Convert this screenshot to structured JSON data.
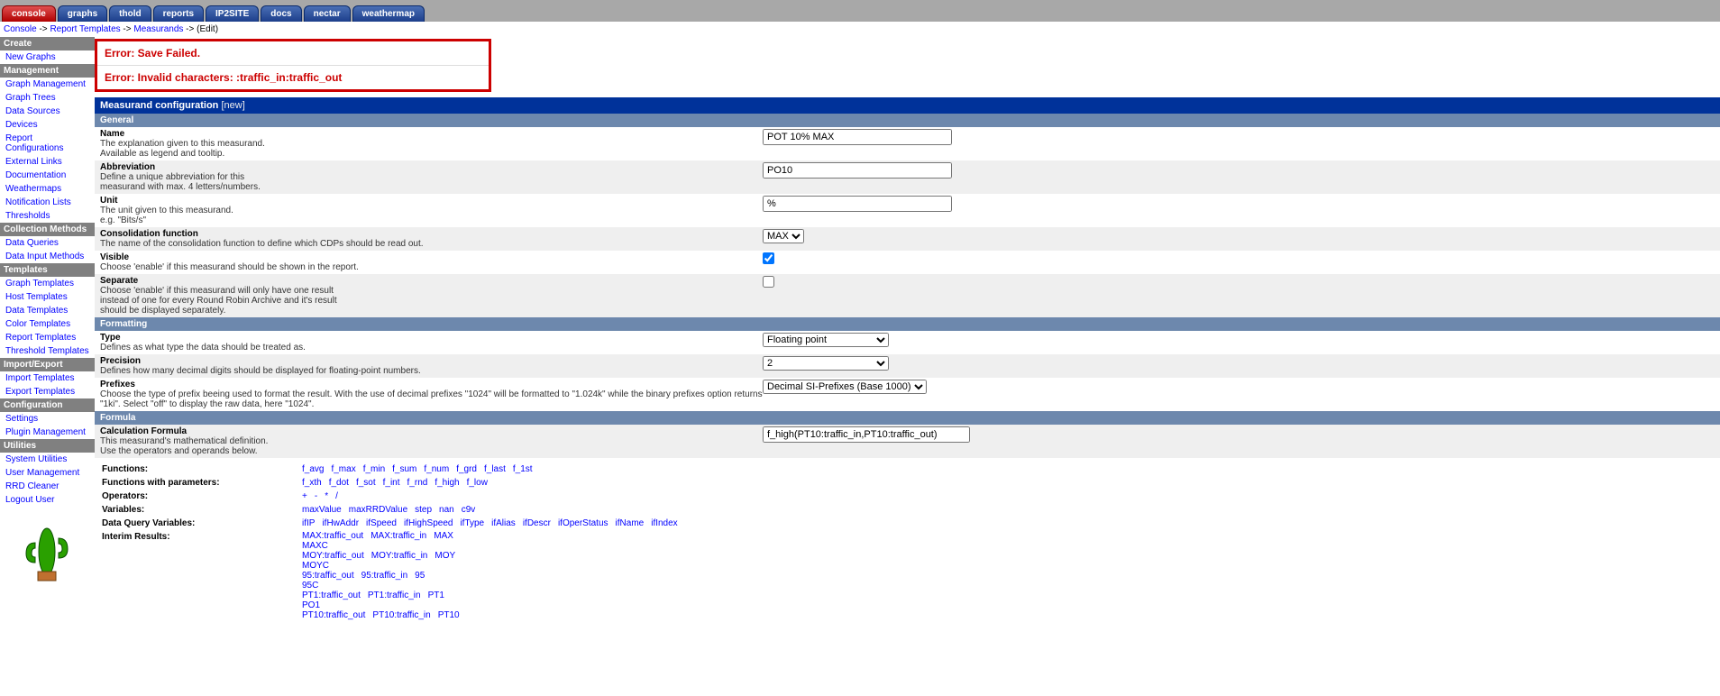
{
  "tabs": [
    {
      "label": "console",
      "active": true
    },
    {
      "label": "graphs"
    },
    {
      "label": "thold"
    },
    {
      "label": "reports"
    },
    {
      "label": "IP2SITE"
    },
    {
      "label": "docs"
    },
    {
      "label": "nectar"
    },
    {
      "label": "weathermap"
    }
  ],
  "breadcrumb": {
    "p0": "Console",
    "sep": " -> ",
    "p1": "Report Templates",
    "p2": "Measurands",
    "p3": "(Edit)"
  },
  "sidebar": {
    "groups": [
      {
        "title": "Create",
        "items": [
          "New Graphs"
        ]
      },
      {
        "title": "Management",
        "items": [
          "Graph Management",
          "Graph Trees",
          "Data Sources",
          "Devices",
          "Report Configurations",
          "External Links",
          "Documentation",
          "Weathermaps",
          "Notification Lists",
          "Thresholds"
        ]
      },
      {
        "title": "Collection Methods",
        "items": [
          "Data Queries",
          "Data Input Methods"
        ]
      },
      {
        "title": "Templates",
        "items": [
          "Graph Templates",
          "Host Templates",
          "Data Templates",
          "Color Templates",
          "Report Templates",
          "Threshold Templates"
        ]
      },
      {
        "title": "Import/Export",
        "items": [
          "Import Templates",
          "Export Templates"
        ]
      },
      {
        "title": "Configuration",
        "items": [
          "Settings",
          "Plugin Management"
        ]
      },
      {
        "title": "Utilities",
        "items": [
          "System Utilities",
          "User Management",
          "RRD Cleaner",
          "Logout User"
        ]
      }
    ]
  },
  "errors": {
    "e1": "Error: Save Failed.",
    "e2": "Error: Invalid characters: :traffic_in:traffic_out"
  },
  "panel": {
    "title": "Measurand configuration",
    "suffix": "[new]",
    "sections": {
      "general": "General",
      "formatting": "Formatting",
      "formula": "Formula"
    },
    "fields": {
      "name": {
        "t": "Name",
        "d": "The explanation given to this measurand.\nAvailable as legend and tooltip.",
        "v": "POT 10% MAX"
      },
      "abbr": {
        "t": "Abbreviation",
        "d": "Define a unique abbreviation for this\nmeasurand with max. 4 letters/numbers.",
        "v": "PO10"
      },
      "unit": {
        "t": "Unit",
        "d": "The unit given to this measurand.\ne.g. \"Bits/s\"",
        "v": "%"
      },
      "cf": {
        "t": "Consolidation function",
        "d": "The name of the consolidation function to define which CDPs should be read out.",
        "v": "MAX"
      },
      "visible": {
        "t": "Visible",
        "d": "Choose 'enable' if this measurand should be shown in the report.",
        "v": true
      },
      "separate": {
        "t": "Separate",
        "d": "Choose 'enable' if this measurand will only have one result\ninstead of one for every Round Robin Archive and it's result\nshould be displayed separately.",
        "v": false
      },
      "type": {
        "t": "Type",
        "d": "Defines as what type the data should be treated as.",
        "v": "Floating point"
      },
      "precision": {
        "t": "Precision",
        "d": "Defines how many decimal digits should be displayed for floating-point numbers.",
        "v": "2"
      },
      "prefixes": {
        "t": "Prefixes",
        "d": "Choose the type of prefix beeing used to format the result. With the use of decimal prefixes \"1024\" will be formatted to \"1.024k\" while the binary prefixes option returns \"1ki\". Select \"off\" to display the raw data, here \"1024\".",
        "v": "Decimal SI-Prefixes (Base 1000)"
      },
      "calc": {
        "t": "Calculation Formula",
        "d": "This measurand's mathematical definition.\nUse the operators and operands below.",
        "v": "f_high(PT10:traffic_in,PT10:traffic_out)"
      }
    }
  },
  "reference": {
    "rows": [
      {
        "k": "Functions:",
        "v": [
          "f_avg",
          "f_max",
          "f_min",
          "f_sum",
          "f_num",
          "f_grd",
          "f_last",
          "f_1st"
        ]
      },
      {
        "k": "Functions with parameters:",
        "v": [
          "f_xth",
          "f_dot",
          "f_sot",
          "f_int",
          "f_rnd",
          "f_high",
          "f_low"
        ]
      },
      {
        "k": "Operators:",
        "v": [
          "+",
          "-",
          "*",
          "/"
        ]
      },
      {
        "k": "Variables:",
        "v": [
          "maxValue",
          "maxRRDValue",
          "step",
          "nan",
          "c9v"
        ]
      },
      {
        "k": "Data Query Variables:",
        "v": [
          "ifIP",
          "ifHwAddr",
          "ifSpeed",
          "ifHighSpeed",
          "ifType",
          "ifAlias",
          "ifDescr",
          "ifOperStatus",
          "ifName",
          "ifIndex"
        ]
      },
      {
        "k": "Interim Results:",
        "v": [
          "MAX:traffic_out",
          "MAX:traffic_in",
          "MAX",
          "MAXC",
          "MOY:traffic_out",
          "MOY:traffic_in",
          "MOY",
          "MOYC",
          "95:traffic_out",
          "95:traffic_in",
          "95",
          "95C",
          "PT1:traffic_out",
          "PT1:traffic_in",
          "PT1",
          "PO1",
          "PT10:traffic_out",
          "PT10:traffic_in",
          "PT10"
        ],
        "wrap": [
          3,
          1,
          3,
          1,
          3,
          1,
          3,
          1,
          3
        ]
      }
    ]
  }
}
